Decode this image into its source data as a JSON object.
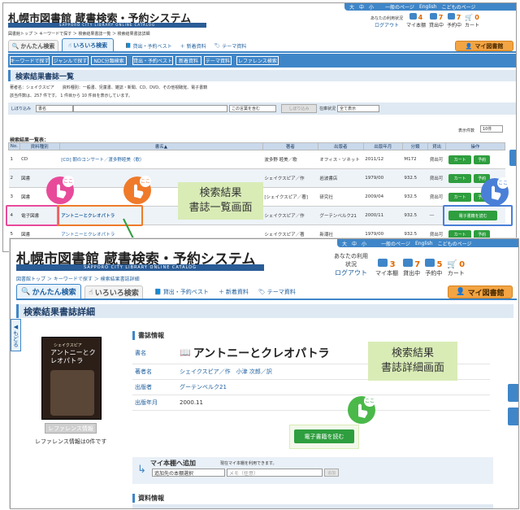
{
  "top": {
    "size_bar": [
      "大",
      "中",
      "小",
      "一般のページ",
      "English",
      "こどものページ"
    ],
    "title": "札幌市図書館 蔵書検索・予約システム",
    "subtitle": "SAPPORO CITY LIBRARY ONLINE CATALOG",
    "status": {
      "usage": "あなたの利用状況",
      "logout": "ログアウト",
      "items": [
        {
          "label": "マイ本棚",
          "count": "4"
        },
        {
          "label": "貸出中",
          "count": "7"
        },
        {
          "label": "予約中",
          "count": "7"
        },
        {
          "label": "カート",
          "count": "0"
        }
      ]
    },
    "breadcrumb": "図書館トップ ＞ キーワードで探す ＞ 検索結果書誌一覧 ＞ 検索結果書誌詳細",
    "tabs": {
      "simple": "かんたん検索",
      "various": "いろいろ検索"
    },
    "links": [
      "貸出・予約ベスト",
      "新着資料",
      "テーマ資料"
    ],
    "mylib": "マイ図書館",
    "nav": [
      "キーワードで探す",
      "ジャンルで探す",
      "NDC分類検索",
      "貸出・予約ベスト",
      "新着資料",
      "テーマ資料",
      "レファレンス検索"
    ],
    "heading": "検索結果書誌一覧",
    "query_line": "著者名：シェイクスピア　　資料種別：一般書、児童書、雑誌・新聞、CD、DVD、その他視聴覚、電子書籍",
    "count_line": "該当件数は、257 件です。 1 件目から 10 件目を表示しています。",
    "filter": {
      "label": "しぼり込み",
      "field": "書名",
      "mode": "この言葉を含む",
      "button": "しぼり込み",
      "status_label": "在庫状況",
      "status_value": "全て表示"
    },
    "per_page_label": "表示件数",
    "per_page": "10件",
    "list_label": "検索結果一覧表：",
    "columns": [
      "No.",
      "資料種別",
      "書名▲",
      "著者",
      "出版者",
      "出版年月",
      "分類",
      "貸出",
      "操作"
    ],
    "rows": [
      {
        "no": "1",
        "type": "CD",
        "title": "[CD] 朝のコンサート／渡多野睦美（歌）",
        "author": "波多野 睦美／歌",
        "pub": "オフィス・ソネット",
        "date": "2011/12",
        "cls": "M172",
        "stat": "貸出可"
      },
      {
        "no": "2",
        "type": "図書",
        "title": "",
        "author": "シェイクスピア／作",
        "pub": "岩波書店",
        "date": "1979/00",
        "cls": "932.5",
        "stat": "貸出可"
      },
      {
        "no": "3",
        "type": "図書",
        "title": "",
        "author": "[シェイクスピア／著]",
        "pub": "研究社",
        "date": "2009/04",
        "cls": "932.5",
        "stat": "貸出可"
      },
      {
        "no": "4",
        "type": "電子図書",
        "title": "アントニーとクレオパトラ",
        "author": "シェイクスピア／作",
        "pub": "グーテンベルク21",
        "date": "2000/11",
        "cls": "932.5",
        "stat": "―"
      },
      {
        "no": "5",
        "type": "図書",
        "title": "アントニーとクレオパトラ",
        "author": "シェイクスピア／著",
        "pub": "新潮社",
        "date": "1979/00",
        "cls": "932.5",
        "stat": "貸出可"
      }
    ],
    "btn_cart": "カート",
    "btn_reserve": "予約",
    "btn_ebook": "電子書籍を読む",
    "caption": "検索結果\n書誌一覧画面",
    "tap_label": "ここ"
  },
  "bottom": {
    "size_bar": [
      "大",
      "中",
      "小",
      "一般のページ",
      "English",
      "こどものページ"
    ],
    "title": "札幌市図書館 蔵書検索・予約システム",
    "subtitle": "SAPPORO CITY LIBRARY ONLINE CATALOG",
    "status": {
      "usage": "あなたの利用状況",
      "logout": "ログアウト",
      "items": [
        {
          "label": "マイ本棚",
          "count": "3"
        },
        {
          "label": "貸出中",
          "count": "7"
        },
        {
          "label": "予約中",
          "count": "5"
        },
        {
          "label": "カート",
          "count": "0"
        }
      ]
    },
    "breadcrumb": "図書館トップ ＞ キーワードで探す ＞ 検索結果書誌詳細",
    "tabs": {
      "simple": "かんたん検索",
      "various": "いろいろ検索"
    },
    "links": [
      "貸出・予約ベスト",
      "新着資料",
      "テーマ資料"
    ],
    "mylib": "マイ図書館",
    "heading": "検索結果書誌詳細",
    "back": "もどる",
    "cover_author": "シェイクスピア",
    "cover_title": "アントニーとクレオパトラ",
    "ref_button": "レファレンス情報",
    "ref_count": "レファレンス情報は0件です",
    "section": "書誌情報",
    "fields": [
      {
        "label": "書名",
        "value": "アントニーとクレオパトラ"
      },
      {
        "label": "著者名",
        "value": "シェイクスピア／作　小津 次郎／訳"
      },
      {
        "label": "出版者",
        "value": "グーテンベルク21"
      },
      {
        "label": "出版年月",
        "value": "2000.11"
      }
    ],
    "ebook_button": "電子書籍を読む",
    "shelf_title": "マイ本棚へ追加",
    "shelf_note": "現在マイ本棚を利用できます。",
    "shelf_select": "追加先の本棚選択",
    "shelf_memo_placeholder": "メモ（任意）",
    "shelf_add": "追加",
    "section2": "資料情報",
    "caption": "検索結果\n書誌詳細画面",
    "tap_label": "ここ"
  },
  "colors": {
    "accent": "#3f86c8",
    "green": "#2e9e3e",
    "orange": "#f3a443",
    "caption_bg": "#d9ecb6"
  }
}
